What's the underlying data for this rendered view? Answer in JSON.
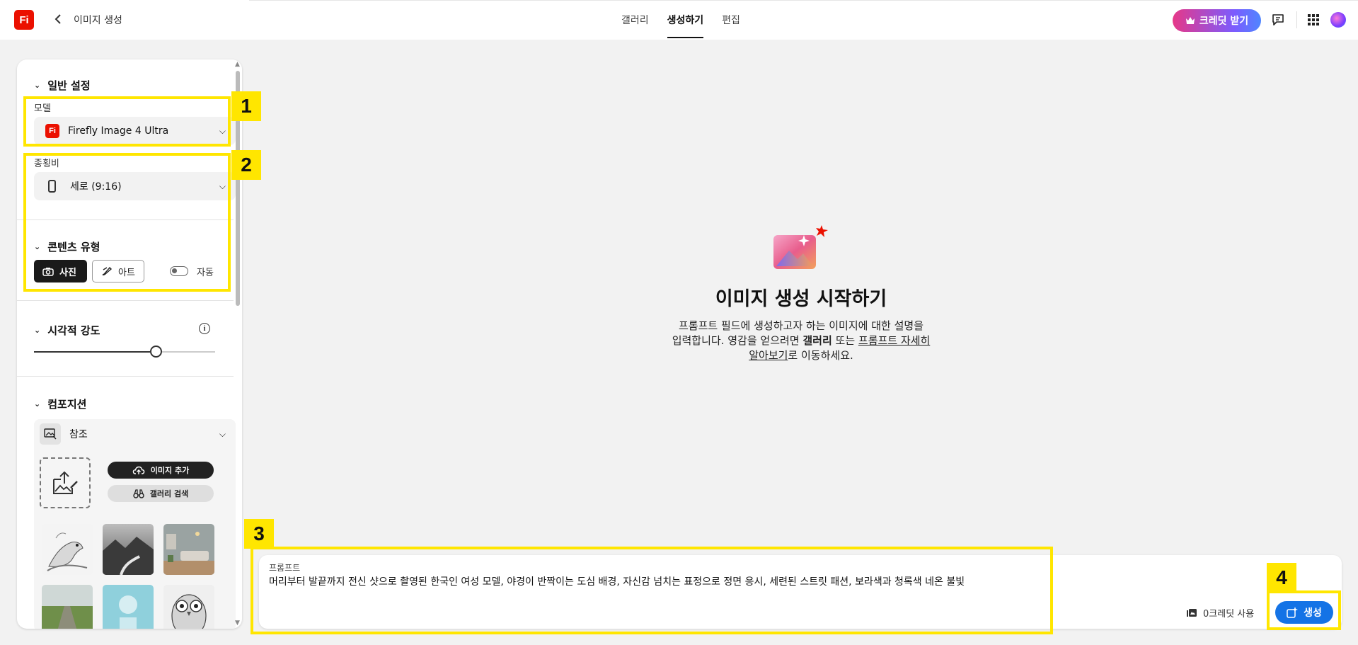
{
  "header": {
    "logo_text": "Fi",
    "back_icon": "chevron-left-icon",
    "page_title": "이미지 생성",
    "tabs": [
      {
        "label": "갤러리",
        "active": false
      },
      {
        "label": "생성하기",
        "active": true
      },
      {
        "label": "편집",
        "active": false
      }
    ],
    "credit_button": "크레딧 받기",
    "credit_button_icon": "crown-icon",
    "icons": [
      "comment-icon",
      "apps-grid-icon"
    ]
  },
  "sidebar": {
    "general": {
      "title": "일반 설정",
      "model_label": "모델",
      "model_value": "Firefly Image 4 Ultra",
      "model_icon_text": "Fi",
      "aspect_label": "종횡비",
      "aspect_value": "세로 (9:16)"
    },
    "content_type": {
      "title": "콘텐츠 유형",
      "photo_label": "사진",
      "art_label": "아트",
      "auto_label": "자동",
      "auto_enabled": false
    },
    "visual_intensity": {
      "title": "시각적 강도",
      "value_fraction": 0.67
    },
    "composition": {
      "title": "컴포지션",
      "reference_label": "참조",
      "add_image_label": "이미지 추가",
      "gallery_search_label": "갤러리 검색",
      "thumbnails": [
        "bird-sketch",
        "mountain-river",
        "living-room",
        "field-road",
        "sphere-pedestal",
        "owl-sketch"
      ]
    }
  },
  "main": {
    "title": "이미지 생성 시작하기",
    "desc_line1": "프롬프트 필드에 생성하고자 하는 이미지에 대한 설명을",
    "desc_line2a": "입력합니다. 영감을 얻으려면 ",
    "desc_gallery": "갤러리",
    "desc_or": " 또는 ",
    "desc_link1": "프롬프트 자세히",
    "desc_link2": "알아보기",
    "desc_end": "로 이동하세요."
  },
  "prompt": {
    "label": "프롬프트",
    "text": "머리부터 발끝까지 전신 샷으로 촬영된 한국인 여성 모델, 야경이 반짝이는 도심 배경, 자신감 넘치는 표정으로 정면 응시, 세련된 스트릿 패션, 보라색과 청록색 네온 불빛",
    "credit_usage": "0크레딧 사용",
    "generate_label": "생성"
  },
  "annotations": [
    "1",
    "2",
    "3",
    "4"
  ],
  "colors": {
    "brand_red": "#eb1000",
    "accent_blue": "#1473e6",
    "annotation_yellow": "#ffe600"
  }
}
